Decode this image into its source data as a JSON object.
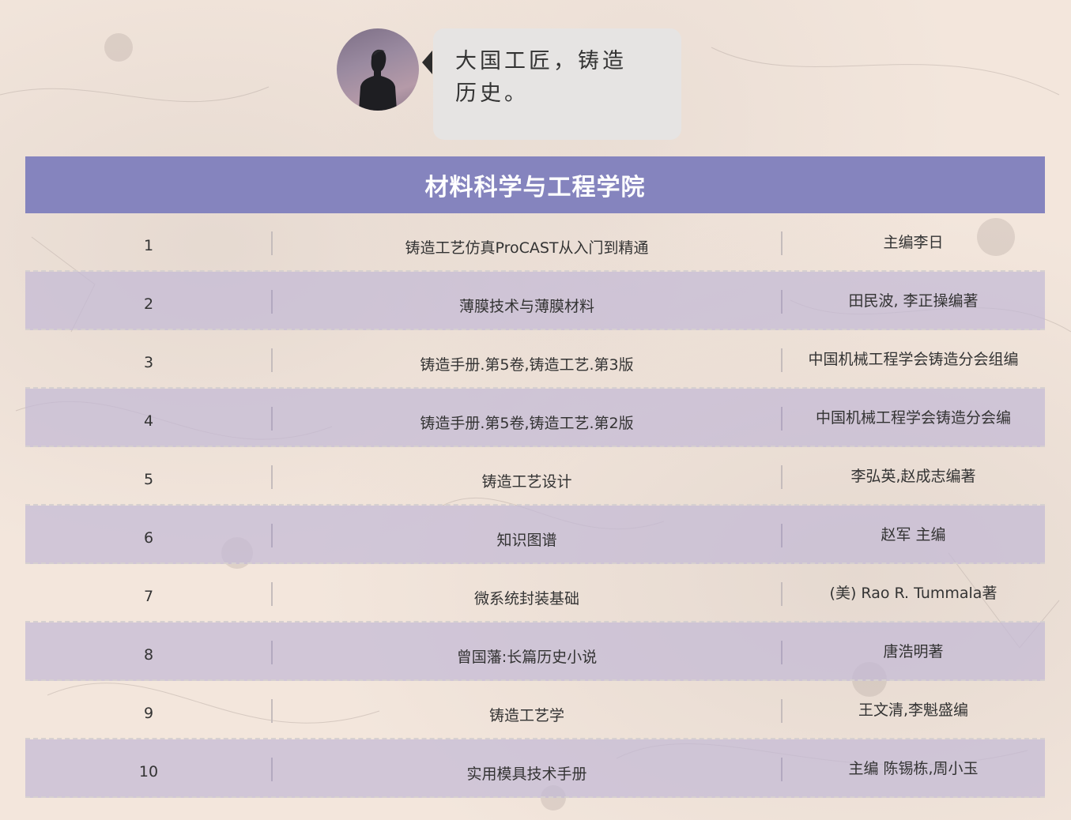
{
  "speaker": {
    "avatar_icon": "person-silhouette-icon",
    "bubble_line1": "大国工匠，铸造",
    "bubble_line2": "历史。"
  },
  "table": {
    "title": "材料科学与工程学院",
    "header_color": "#8584be",
    "shaded_row_color": "#c4bad6",
    "rows": [
      {
        "num": "1",
        "title": "铸造工艺仿真ProCAST从入门到精通",
        "author": "主编李日"
      },
      {
        "num": "2",
        "title": "薄膜技术与薄膜材料",
        "author": "田民波, 李正操编著"
      },
      {
        "num": "3",
        "title": "铸造手册.第5卷,铸造工艺.第3版",
        "author": "中国机械工程学会铸造分会组编"
      },
      {
        "num": "4",
        "title": "铸造手册.第5卷,铸造工艺.第2版",
        "author": "中国机械工程学会铸造分会编"
      },
      {
        "num": "5",
        "title": "铸造工艺设计",
        "author": "李弘英,赵成志编著"
      },
      {
        "num": "6",
        "title": "知识图谱",
        "author": "赵军 主编"
      },
      {
        "num": "7",
        "title": "微系统封装基础",
        "author": "(美) Rao R. Tummala著"
      },
      {
        "num": "8",
        "title": "曾国藩:长篇历史小说",
        "author": "唐浩明著"
      },
      {
        "num": "9",
        "title": "铸造工艺学",
        "author": "王文清,李魁盛编"
      },
      {
        "num": "10",
        "title": "实用模具技术手册",
        "author": "主编 陈锡栋,周小玉"
      }
    ]
  }
}
